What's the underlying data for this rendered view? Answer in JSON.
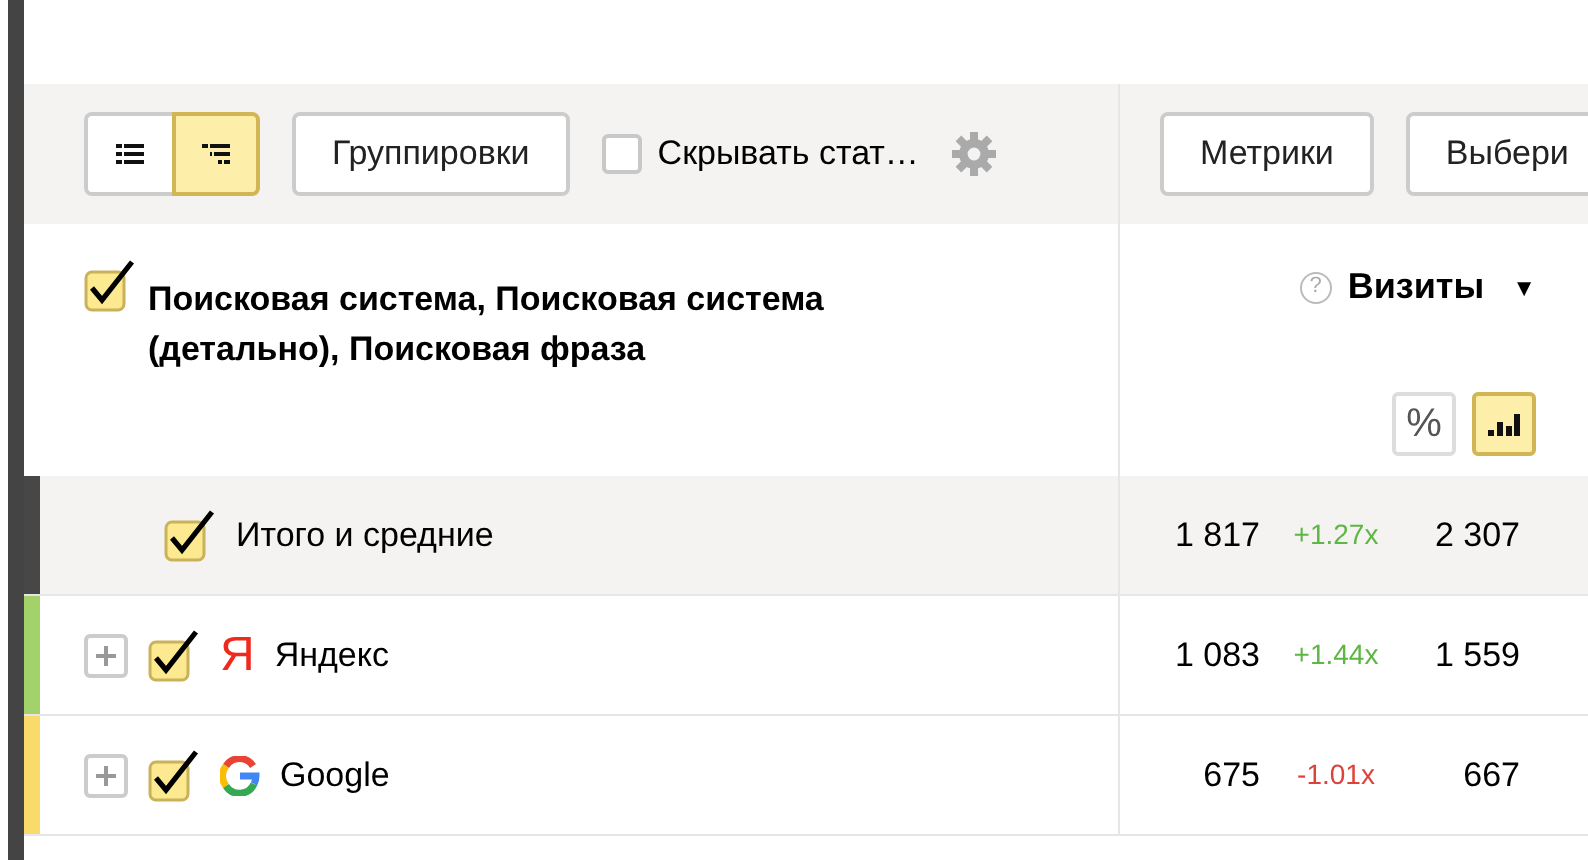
{
  "toolbar": {
    "view_toggle": [
      {
        "kind": "list",
        "selected": false
      },
      {
        "kind": "tree",
        "selected": true
      }
    ],
    "groupings_button": "Группировки",
    "hide_checkbox": {
      "label": "Скрывать стат…",
      "checked": false
    },
    "metrics_button": "Метрики",
    "select_button": "Выбери"
  },
  "header": {
    "checked": true,
    "title": "Поисковая система, Поисковая система (детально), Поисковая фраза",
    "metric": "Визиты",
    "help": "?",
    "sort_arrow": "▼",
    "mode_toggle": [
      {
        "kind": "text",
        "text": "%",
        "selected": false
      },
      {
        "kind": "bars",
        "selected": true
      }
    ]
  },
  "rows": [
    {
      "kind": "total",
      "color": "#474747",
      "checked": true,
      "label": "Итого и средние",
      "values": [
        "1 817",
        "+1.27x",
        "2 307"
      ],
      "growth": true
    },
    {
      "kind": "item",
      "color": "#a3d16a",
      "checked": true,
      "logo": {
        "kind": "letter",
        "text": "Я"
      },
      "label": "Яндекс",
      "values": [
        "1 083",
        "+1.44x",
        "1 559"
      ],
      "growth": true
    },
    {
      "kind": "item",
      "color": "#f9da6b",
      "checked": true,
      "logo": {
        "kind": "g"
      },
      "label": "Google",
      "values": [
        "675",
        "-1.01x",
        "667"
      ],
      "growth": false
    }
  ]
}
